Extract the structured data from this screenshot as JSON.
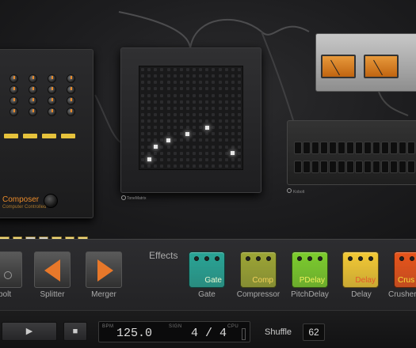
{
  "rack": {
    "composer": {
      "title": "Composer",
      "subtitle": "Computer Controlled"
    },
    "tonematrix": {
      "label": "ToneMatrix"
    },
    "kobolt": {
      "label": "Kobolt"
    }
  },
  "effects": {
    "title": "Effects",
    "devices": [
      {
        "label": "Kobolt",
        "icon": "kobolt-icon"
      },
      {
        "label": "Splitter",
        "icon": "splitter-icon"
      },
      {
        "label": "Merger",
        "icon": "merger-icon"
      }
    ],
    "pedals": [
      {
        "label": "Gate",
        "text": "Gate",
        "color": "#2aa596",
        "textColor": "#e9f7d0"
      },
      {
        "label": "Compressor",
        "text": "Comp",
        "color": "#9da636",
        "textColor": "#f3d15a"
      },
      {
        "label": "PitchDelay",
        "text": "PDelay",
        "color": "#7dcd2e",
        "textColor": "#f2ef5c"
      },
      {
        "label": "Delay",
        "text": "Delay",
        "color": "#f3c936",
        "textColor": "#e4572a"
      },
      {
        "label": "Crusher",
        "text": "Crus",
        "color": "#e8551c",
        "textColor": "#f5e03a"
      }
    ]
  },
  "transport": {
    "play_icon": "play-icon",
    "stop_icon": "stop-icon",
    "bpm_label": "BPM",
    "bpm_value": "125.0",
    "sign_label": "SIGN",
    "sign_value": "4 / 4",
    "cpu_label": "CPU",
    "shuffle_label": "Shuffle",
    "shuffle_value": "62"
  }
}
